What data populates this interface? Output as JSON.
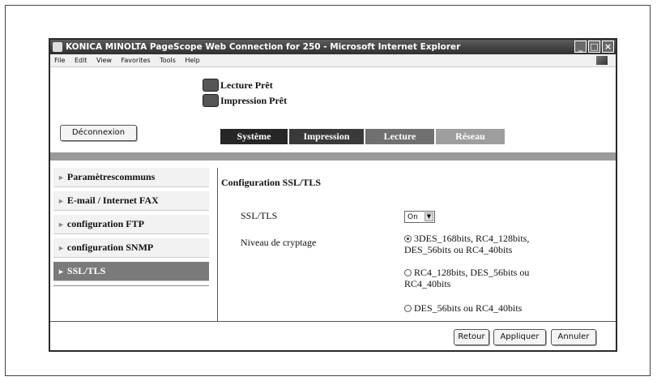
{
  "window": {
    "title": "KONICA MINOLTA PageScope Web Connection for 250 - Microsoft Internet Explorer"
  },
  "menu": [
    "File",
    "Edit",
    "View",
    "Favorites",
    "Tools",
    "Help"
  ],
  "status": {
    "scan": "Lecture Prêt",
    "print": "Impression Prêt"
  },
  "logout_label": "Déconnexion",
  "tabs": [
    "Système",
    "Impression",
    "Lecture",
    "Réseau"
  ],
  "sidebar": {
    "items": [
      "Paramètrescommuns",
      "E-mail / Internet FAX",
      "configuration FTP",
      "configuration SNMP",
      "SSL/TLS"
    ],
    "active": "SSL/TLS"
  },
  "main": {
    "title": "Configuration SSL/TLS",
    "ssl_label": "SSL/TLS",
    "ssl_value": "On",
    "encryption_label": "Niveau de cryptage",
    "options": [
      "3DES_168bits, RC4_128bits, DES_56bits ou RC4_40bits",
      "RC4_128bits, DES_56bits ou RC4_40bits",
      "DES_56bits ou RC4_40bits"
    ],
    "selected_option": 0
  },
  "buttons": {
    "back": "Retour",
    "apply": "Appliquer",
    "cancel": "Annuler"
  }
}
